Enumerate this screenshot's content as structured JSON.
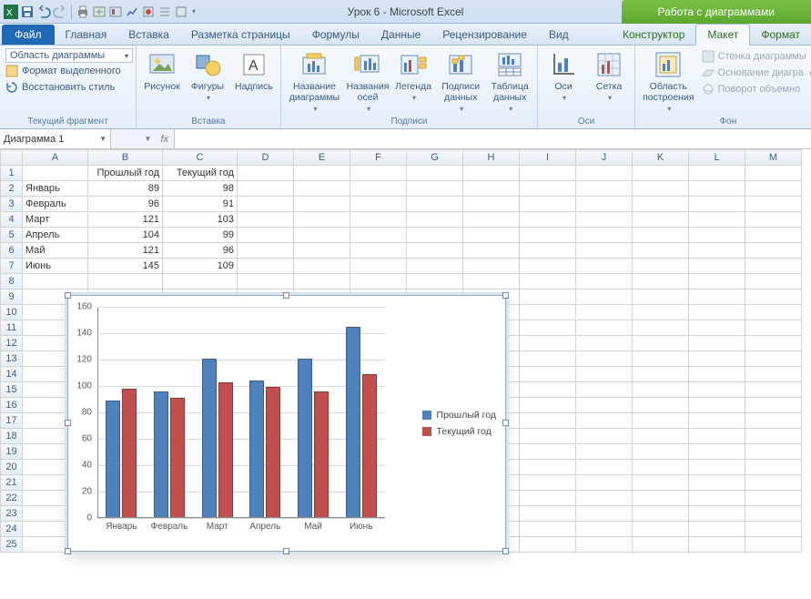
{
  "title": "Урок 6  -  Microsoft Excel",
  "chart_tools_title": "Работа с диаграммами",
  "tabs": {
    "file": "Файл",
    "list": [
      "Главная",
      "Вставка",
      "Разметка страницы",
      "Формулы",
      "Данные",
      "Рецензирование",
      "Вид"
    ],
    "ctx": [
      "Конструктор",
      "Макет",
      "Формат"
    ],
    "active": "Макет"
  },
  "ribbon": {
    "fragment": {
      "selector": "Область диаграммы",
      "format_sel": "Формат выделенного",
      "reset": "Восстановить стиль",
      "label": "Текущий фрагмент"
    },
    "insert": {
      "picture": "Рисунок",
      "shapes": "Фигуры",
      "textbox": "Надпись",
      "label": "Вставка"
    },
    "labels": {
      "title": "Название диаграммы",
      "axis": "Названия осей",
      "legend": "Легенда",
      "datalabels": "Подписи данных",
      "datatable": "Таблица данных",
      "label": "Подписи"
    },
    "axes": {
      "axes": "Оси",
      "grid": "Сетка",
      "label": "Оси"
    },
    "bg": {
      "plotarea": "Область построения",
      "wall": "Стенка диаграммы",
      "floor": "Основание диагра",
      "rot": "Поворот объемно",
      "label": "Фон"
    }
  },
  "namebox": "Диаграмма 1",
  "fx": "fx",
  "columns": [
    "A",
    "B",
    "C",
    "D",
    "E",
    "F",
    "G",
    "H",
    "I",
    "J",
    "K",
    "L",
    "M"
  ],
  "row_headers": [
    "1",
    "2",
    "3",
    "4",
    "5",
    "6",
    "7",
    "8",
    "9",
    "10",
    "11",
    "12",
    "13",
    "14",
    "15",
    "16",
    "17",
    "18",
    "19",
    "20",
    "21",
    "22",
    "23",
    "24",
    "25"
  ],
  "table": {
    "headers": [
      "Прошлый год",
      "Текущий год"
    ],
    "rows": [
      {
        "label": "Январь",
        "a": 89,
        "b": 98
      },
      {
        "label": "Февраль",
        "a": 96,
        "b": 91
      },
      {
        "label": "Март",
        "a": 121,
        "b": 103
      },
      {
        "label": "Апрель",
        "a": 104,
        "b": 99
      },
      {
        "label": "Май",
        "a": 121,
        "b": 96
      },
      {
        "label": "Июнь",
        "a": 145,
        "b": 109
      }
    ]
  },
  "chart_data": {
    "type": "bar",
    "categories": [
      "Январь",
      "Февраль",
      "Март",
      "Апрель",
      "Май",
      "Июнь"
    ],
    "series": [
      {
        "name": "Прошлый год",
        "values": [
          89,
          96,
          121,
          104,
          121,
          145
        ],
        "color": "#4f81bd"
      },
      {
        "name": "Текущий год",
        "values": [
          98,
          91,
          103,
          99,
          96,
          109
        ],
        "color": "#c0504d"
      }
    ],
    "ylim": [
      0,
      160
    ],
    "yticks": [
      0,
      20,
      40,
      60,
      80,
      100,
      120,
      140,
      160
    ],
    "title": "",
    "xlabel": "",
    "ylabel": "",
    "legend_position": "right"
  }
}
